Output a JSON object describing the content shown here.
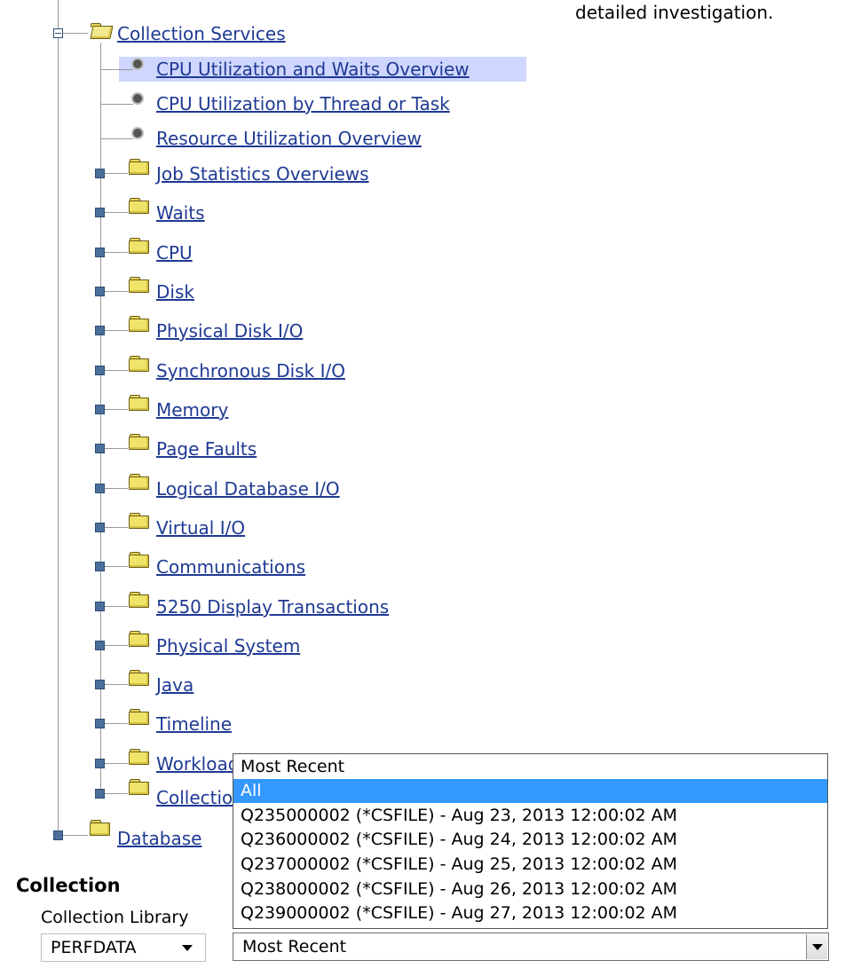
{
  "top_text": "detailed investigation.",
  "tree": {
    "collection_services": "Collection Services",
    "children": [
      "CPU Utilization and Waits Overview",
      "CPU Utilization by Thread or Task",
      "Resource Utilization Overview"
    ],
    "folders": [
      "Job Statistics Overviews",
      "Waits",
      "CPU",
      "Disk",
      "Physical Disk I/O",
      "Synchronous Disk I/O",
      "Memory",
      "Page Faults",
      "Logical Database I/O",
      "Virtual I/O",
      "Communications",
      "5250 Display Transactions",
      "Physical System",
      "Java",
      "Timeline",
      "Workload",
      "Collection"
    ],
    "database": "Database"
  },
  "collection": {
    "heading": "Collection",
    "library_label": "Collection Library",
    "library_value": "PERFDATA",
    "collection_value": "Most Recent",
    "dropdown_options": [
      "Most Recent",
      "All",
      "Q235000002 (*CSFILE) - Aug 23, 2013 12:00:02 AM",
      "Q236000002 (*CSFILE) - Aug 24, 2013 12:00:02 AM",
      "Q237000002 (*CSFILE) - Aug 25, 2013 12:00:02 AM",
      "Q238000002 (*CSFILE) - Aug 26, 2013 12:00:02 AM",
      "Q239000002 (*CSFILE) - Aug 27, 2013 12:00:02 AM"
    ]
  },
  "colors": {
    "link": "#1f3a93",
    "selection": "#3399ff",
    "highlight": "#cfd6ff"
  }
}
